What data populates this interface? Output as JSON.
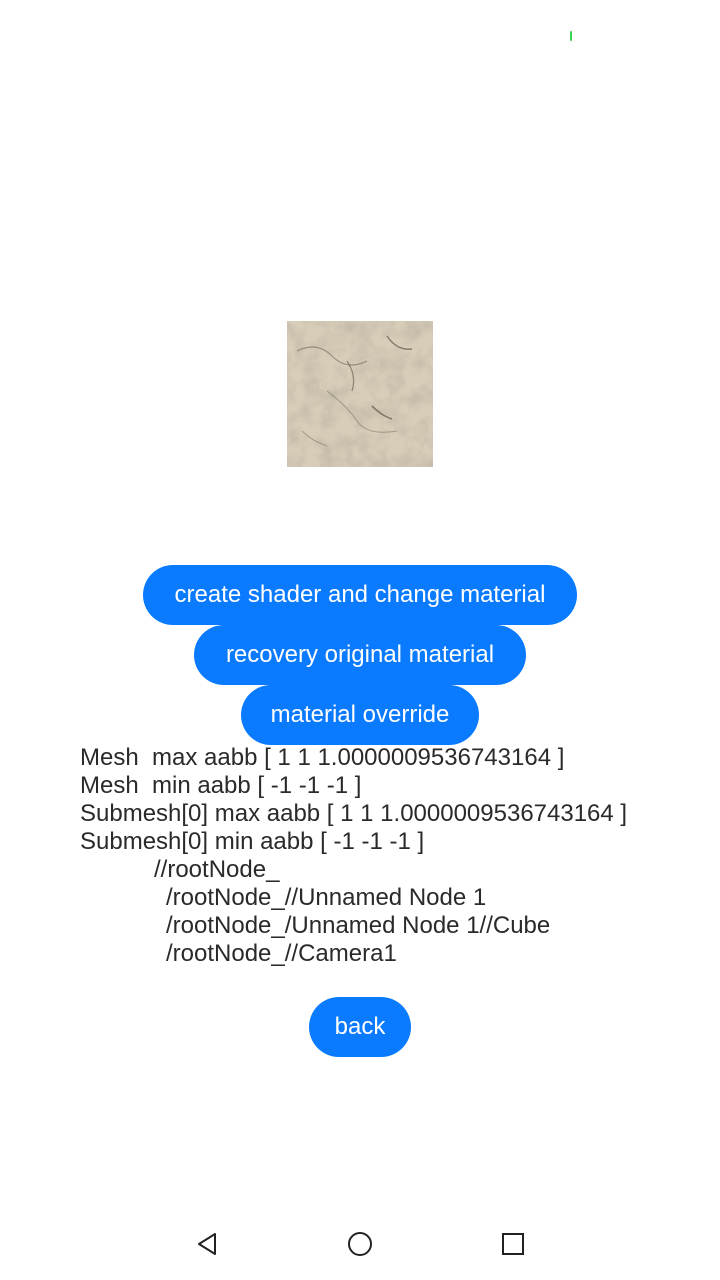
{
  "status": {
    "indicator_color": "#39d353"
  },
  "scene": {
    "description_icon": "textured-cube-icon",
    "texture_color": "#d8cdb8"
  },
  "buttons": {
    "create_shader": "create shader and change material",
    "recovery": "recovery original material",
    "override": "material override",
    "back": "back",
    "color": "#0a7aff"
  },
  "info_lines": [
    "Mesh  max aabb [ 1 1 1.0000009536743164 ]",
    "Mesh  min aabb [ -1 -1 -1 ]",
    "Submesh[0] max aabb [ 1 1 1.0000009536743164 ]",
    "Submesh[0] min aabb [ -1 -1 -1 ]",
    "//rootNode_",
    "/rootNode_//Unnamed Node 1",
    "/rootNode_/Unnamed Node 1//Cube",
    "/rootNode_//Camera1"
  ],
  "navbar": {
    "back_icon": "triangle-back-icon",
    "home_icon": "circle-home-icon",
    "recent_icon": "square-recent-icon"
  }
}
